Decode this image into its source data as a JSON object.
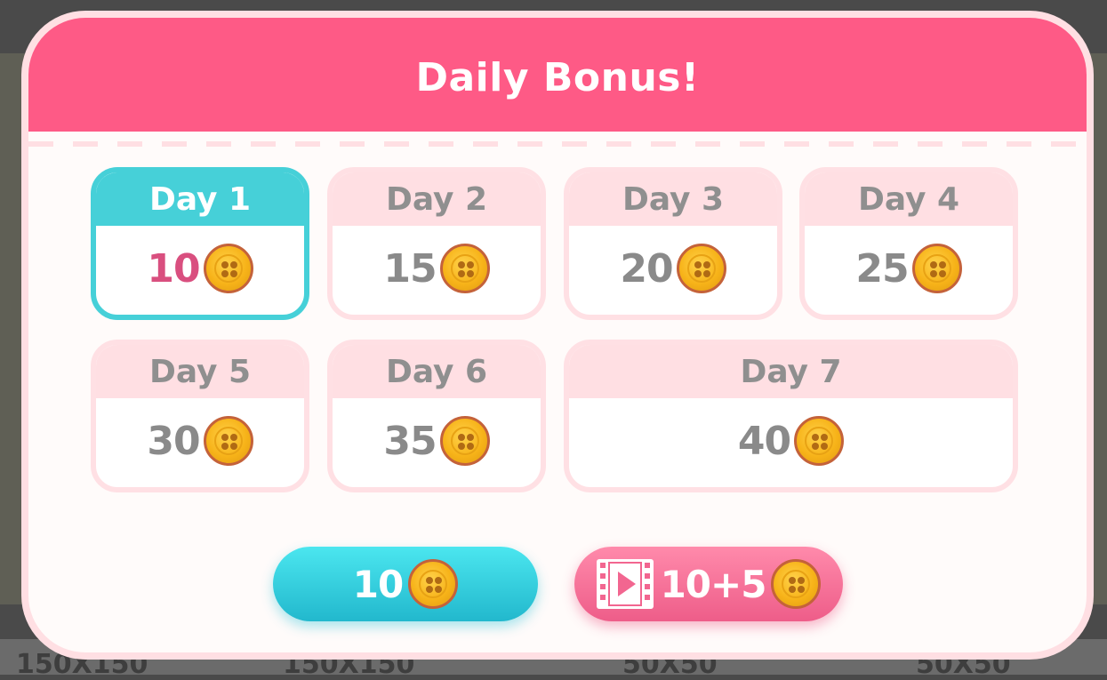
{
  "title": "Daily Bonus!",
  "background_labels": [
    "150X150",
    "150X150",
    "50X50",
    "50X50"
  ],
  "days": [
    {
      "label": "Day 1",
      "amount": "10",
      "active": true
    },
    {
      "label": "Day 2",
      "amount": "15",
      "active": false
    },
    {
      "label": "Day 3",
      "amount": "20",
      "active": false
    },
    {
      "label": "Day 4",
      "amount": "25",
      "active": false
    },
    {
      "label": "Day 5",
      "amount": "30",
      "active": false
    },
    {
      "label": "Day 6",
      "amount": "35",
      "active": false
    },
    {
      "label": "Day 7",
      "amount": "40",
      "active": false
    }
  ],
  "buttons": {
    "claim_amount": "10",
    "video_amount": "10+5"
  },
  "icons": {
    "coin": "button-coin-icon",
    "video": "film-play-icon"
  },
  "colors": {
    "header": "#fe5a86",
    "active": "#46d0d8",
    "inactive_cap": "#ffdfe3",
    "active_amount": "#d94f7f",
    "claim_button": "#2ccfe0",
    "video_button": "#f26690"
  }
}
